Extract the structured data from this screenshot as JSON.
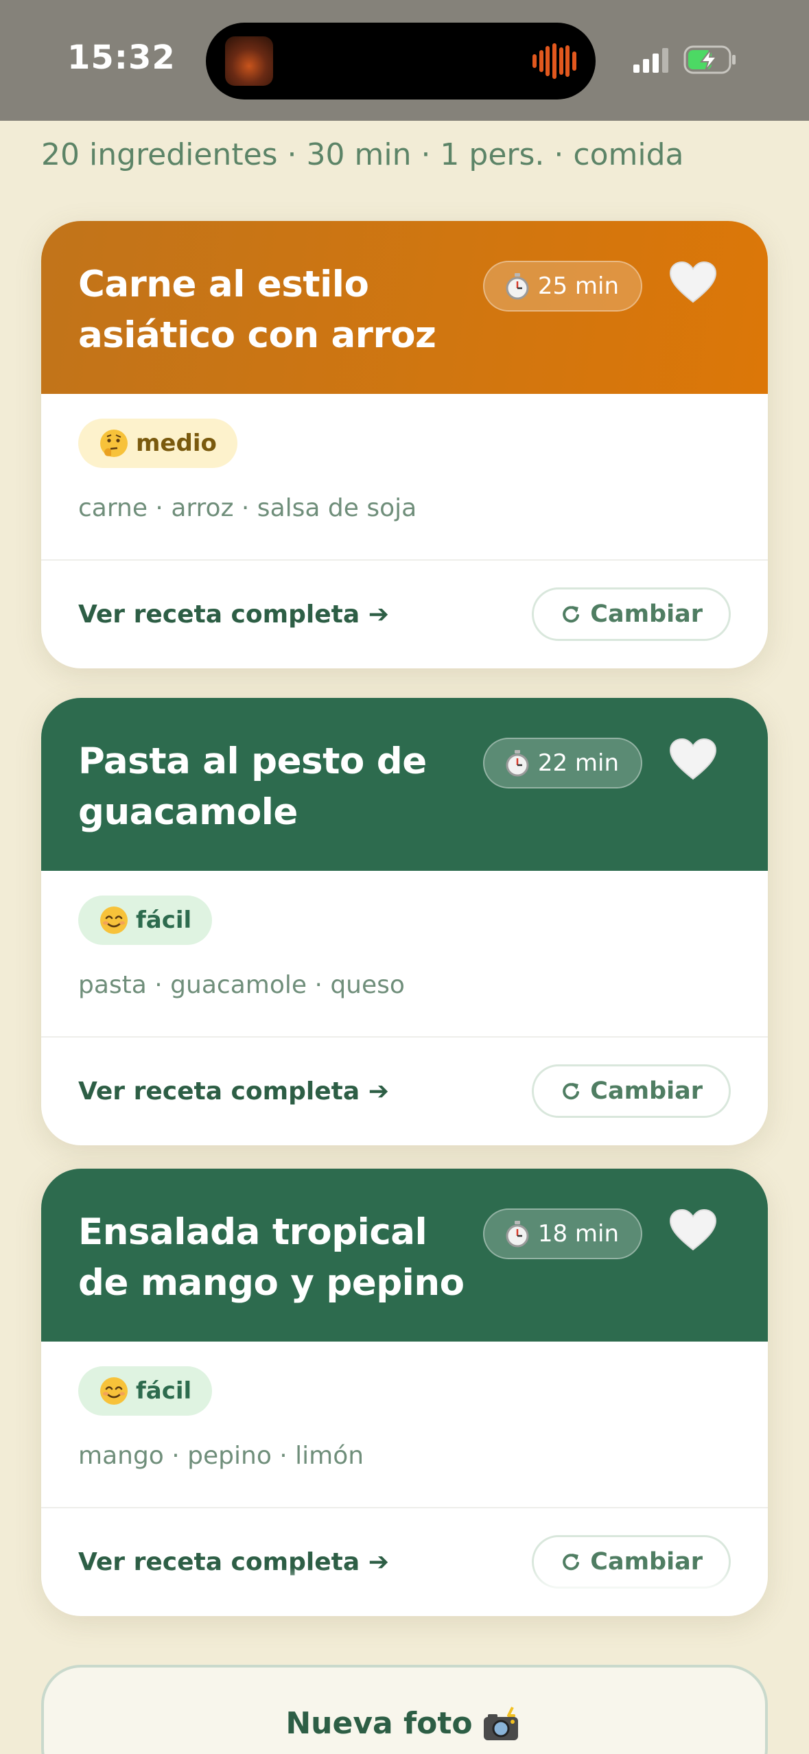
{
  "status_bar": {
    "time": "15:32"
  },
  "summary": "20 ingredientes · 30 min · 1 pers. · comida",
  "recipes": [
    {
      "title": "Carne al estilo asiático con arroz",
      "time": "25 min",
      "difficulty": "medio",
      "difficulty_level": "medium",
      "ingredients": "carne · arroz · salsa de soja",
      "header_color": "#d47610",
      "link_label": "Ver receta completa ➔",
      "swap_label": "Cambiar"
    },
    {
      "title": "Pasta al pesto de guacamole",
      "time": "22 min",
      "difficulty": "fácil",
      "difficulty_level": "easy",
      "ingredients": "pasta · guacamole · queso",
      "header_color": "#2d6b4e",
      "link_label": "Ver receta completa ➔",
      "swap_label": "Cambiar"
    },
    {
      "title": "Ensalada tropical de mango y pepino",
      "time": "18 min",
      "difficulty": "fácil",
      "difficulty_level": "easy",
      "ingredients": "mango · pepino · limón",
      "header_color": "#2d6b4e",
      "link_label": "Ver receta completa ➔",
      "swap_label": "Cambiar"
    }
  ],
  "new_photo_label": "Nueva foto",
  "icons": {
    "time": "stopwatch-icon",
    "favorite": "heart-icon",
    "difficulty_medium": "thinking-face-icon",
    "difficulty_easy": "smiling-face-icon",
    "swap": "refresh-icon",
    "new_photo": "camera-flash-icon"
  },
  "colors": {
    "background": "#f2ecd6",
    "brand_green": "#2d6b4e",
    "accent_orange": "#d47610",
    "status_bar": "#85827a"
  }
}
